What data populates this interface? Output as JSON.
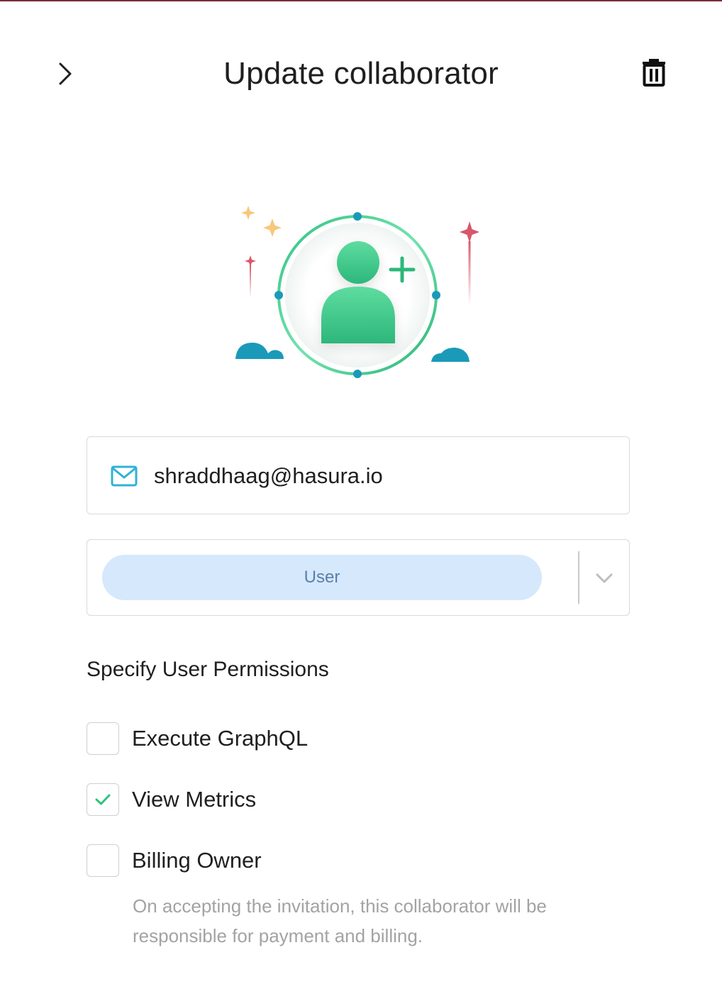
{
  "header": {
    "title": "Update collaborator",
    "back_icon": "chevron-right-icon",
    "delete_icon": "trash-icon"
  },
  "email": {
    "icon": "mail-icon",
    "value": "shraddhaag@hasura.io"
  },
  "role": {
    "selected": "User",
    "dropdown_icon": "chevron-down-icon"
  },
  "permissions": {
    "heading": "Specify User Permissions",
    "items": [
      {
        "label": "Execute GraphQL",
        "checked": false
      },
      {
        "label": "View Metrics",
        "checked": true
      },
      {
        "label": "Billing Owner",
        "checked": false
      }
    ],
    "billing_note": "On accepting the invitation, this collaborator will be responsible for payment and billing."
  },
  "colors": {
    "accent_green": "#34c17d",
    "mail_icon": "#2fb2d6",
    "role_pill_bg": "#d6e8fc",
    "role_pill_text": "#5a80a8",
    "sparkle_red": "#d8566b",
    "sparkle_yellow": "#f7c77a",
    "cloud_teal": "#1a9ab8"
  }
}
